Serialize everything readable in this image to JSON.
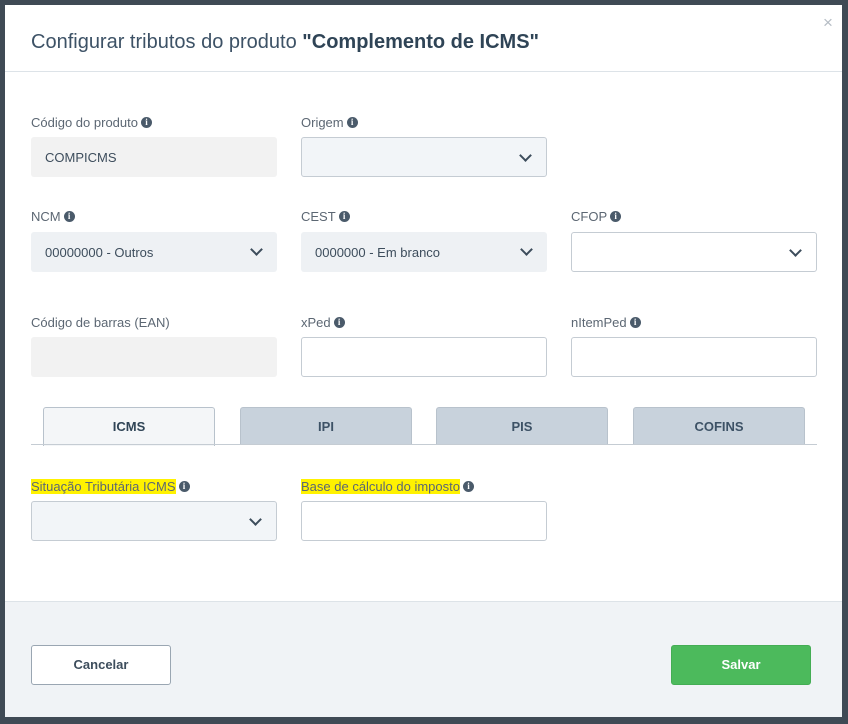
{
  "modal": {
    "title_prefix": "Configurar tributos do produto ",
    "title_product": "\"Complemento de ICMS\"",
    "close_label": "×"
  },
  "fields": {
    "codigo_produto": {
      "label": "Código do produto",
      "value": "COMPICMS"
    },
    "origem": {
      "label": "Origem",
      "value": ""
    },
    "ncm": {
      "label": "NCM",
      "value": "00000000 - Outros"
    },
    "cest": {
      "label": "CEST",
      "value": "0000000 - Em branco"
    },
    "cfop": {
      "label": "CFOP",
      "value": ""
    },
    "codigo_barras": {
      "label": "Código de barras (EAN)",
      "value": ""
    },
    "xped": {
      "label": "xPed",
      "value": ""
    },
    "nitemped": {
      "label": "nItemPed",
      "value": ""
    }
  },
  "tabs": [
    {
      "label": "ICMS",
      "active": true
    },
    {
      "label": "IPI",
      "active": false
    },
    {
      "label": "PIS",
      "active": false
    },
    {
      "label": "COFINS",
      "active": false
    }
  ],
  "icms": {
    "situacao": {
      "label": "Situação Tributária ICMS",
      "value": ""
    },
    "base_calculo": {
      "label": "Base de cálculo do imposto",
      "value": ""
    }
  },
  "footer": {
    "cancel_label": "Cancelar",
    "save_label": "Salvar"
  },
  "info_glyph": "i",
  "colors": {
    "primary_text": "#3d5266",
    "save_green": "#4cba5c",
    "highlight": "#fff200",
    "tab_inactive": "#c8d2dc"
  }
}
